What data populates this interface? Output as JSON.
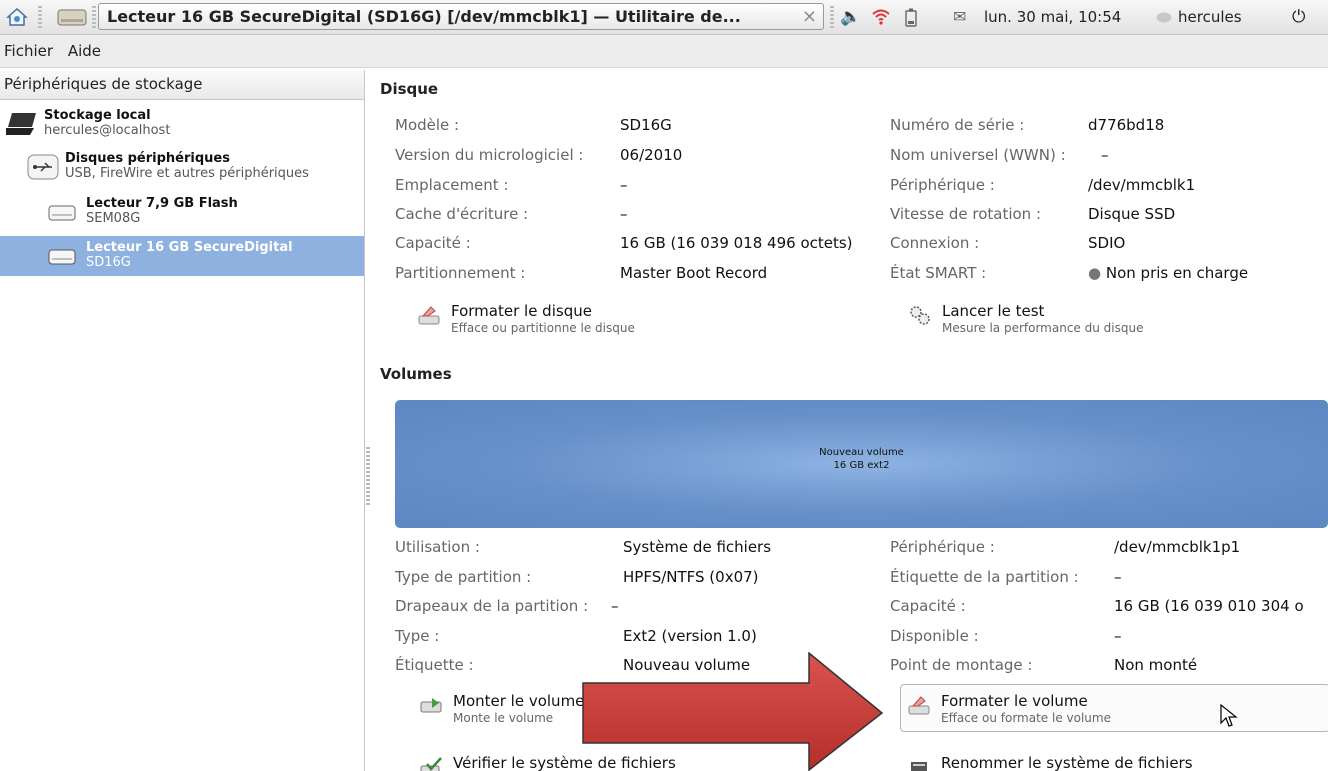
{
  "topbar": {
    "window_title": "Lecteur 16 GB SecureDigital (SD16G) [/dev/mmcblk1] — Utilitaire de...",
    "datetime": "lun. 30 mai, 10:54",
    "user": "hercules"
  },
  "menu": {
    "file": "Fichier",
    "help": "Aide"
  },
  "left": {
    "header": "Périphériques de stockage",
    "items": [
      {
        "title": "Stockage local",
        "subtitle": "hercules@localhost"
      },
      {
        "title": "Disques périphériques",
        "subtitle": "USB, FireWire et autres périphériques"
      },
      {
        "title": "Lecteur 7,9 GB Flash",
        "subtitle": "SEM08G"
      },
      {
        "title": "Lecteur 16 GB SecureDigital",
        "subtitle": "SD16G"
      }
    ]
  },
  "disk": {
    "title": "Disque",
    "left": [
      {
        "label": "Modèle :",
        "value": "SD16G"
      },
      {
        "label": "Version du micrologiciel :",
        "value": "06/2010"
      },
      {
        "label": "Emplacement :",
        "value": "–"
      },
      {
        "label": "Cache d'écriture :",
        "value": "–"
      },
      {
        "label": "Capacité :",
        "value": "16 GB (16 039 018 496 octets)"
      },
      {
        "label": "Partitionnement :",
        "value": "Master Boot Record"
      }
    ],
    "right": [
      {
        "label": "Numéro de série :",
        "value": "d776bd18"
      },
      {
        "label": "Nom universel (WWN) :",
        "value": "–"
      },
      {
        "label": "Périphérique :",
        "value": "/dev/mmcblk1"
      },
      {
        "label": "Vitesse de rotation :",
        "value": "Disque SSD"
      },
      {
        "label": "Connexion :",
        "value": "SDIO"
      },
      {
        "label": "État SMART :",
        "value": "Non pris en charge"
      }
    ],
    "actions": [
      {
        "title": "Formater le disque",
        "subtitle": "Efface ou partitionne le disque"
      },
      {
        "title": "Lancer le test",
        "subtitle": "Mesure la performance du disque"
      }
    ]
  },
  "volumes": {
    "title": "Volumes",
    "bar_name": "Nouveau volume",
    "bar_size": "16 GB ext2",
    "left": [
      {
        "label": "Utilisation :",
        "value": "Système de fichiers"
      },
      {
        "label": "Type de partition :",
        "value": "HPFS/NTFS (0x07)"
      },
      {
        "label": "Drapeaux de la partition :",
        "value": "–"
      },
      {
        "label": "Type :",
        "value": "Ext2 (version 1.0)"
      },
      {
        "label": "Étiquette :",
        "value": "Nouveau volume"
      }
    ],
    "right": [
      {
        "label": "Périphérique :",
        "value": "/dev/mmcblk1p1"
      },
      {
        "label": "Étiquette de la partition :",
        "value": "–"
      },
      {
        "label": "Capacité :",
        "value": "16 GB (16 039 010 304 o"
      },
      {
        "label": "Disponible :",
        "value": "–"
      },
      {
        "label": "Point de montage :",
        "value": "Non monté"
      }
    ],
    "actions": [
      {
        "title": "Monter le volume",
        "subtitle": "Monte le volume"
      },
      {
        "title": "Formater le volume",
        "subtitle": "Efface ou formate le volume"
      },
      {
        "title": "Vérifier le système de fichiers"
      },
      {
        "title": "Renommer le système de fichiers"
      }
    ]
  },
  "colors": {
    "selection": "#8fb1e0",
    "volume_bar": "#6690c8",
    "arrow": "#c23a36"
  }
}
